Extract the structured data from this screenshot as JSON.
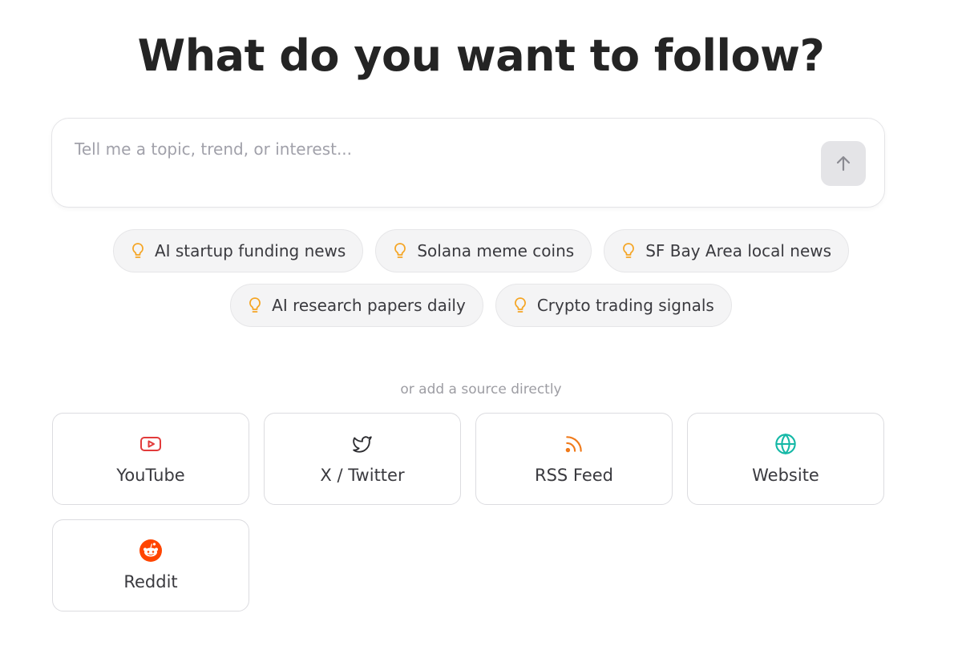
{
  "heading": "What do you want to follow?",
  "composer": {
    "placeholder": "Tell me a topic, trend, or interest...",
    "value": "",
    "send_icon": "arrow-up-icon"
  },
  "suggestions": {
    "icon": "lightbulb-icon",
    "icon_color": "#f5a524",
    "row1": [
      "AI startup funding news",
      "Solana meme coins",
      "SF Bay Area local news"
    ],
    "row2": [
      "AI research papers daily",
      "Crypto trading signals"
    ]
  },
  "sources_divider": "or add a source directly",
  "sources": [
    {
      "label": "YouTube",
      "icon": "youtube-icon",
      "color": "#e23b3b"
    },
    {
      "label": "X / Twitter",
      "icon": "twitter-bird-icon",
      "color": "#2a2a2e"
    },
    {
      "label": "RSS Feed",
      "icon": "rss-icon",
      "color": "#f07a1a"
    },
    {
      "label": "Website",
      "icon": "globe-icon",
      "color": "#14b8a6"
    },
    {
      "label": "Reddit",
      "icon": "reddit-icon",
      "color": "#ff4500"
    }
  ]
}
